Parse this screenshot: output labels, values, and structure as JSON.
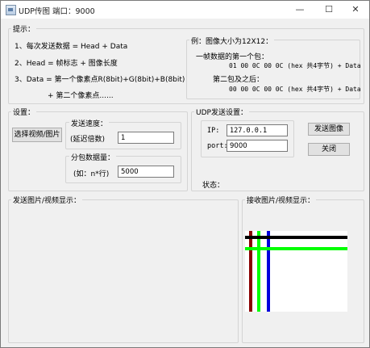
{
  "window": {
    "title": "UDP传图    端口：9000",
    "min_glyph": "—",
    "max_glyph": "☐",
    "close_glyph": "✕"
  },
  "tips": {
    "label": "提示：",
    "line1": "1、每次发送数据 = Head + Data",
    "line2": "2、Head = 帧标志 + 图像长度",
    "line3": "3、Data = 第一个像素点R(8bit)+G(8bit)+B(8bit)",
    "line4": "+ 第二个像素点......",
    "example_label": "例：图像大小为12X12：",
    "first_packet_label": "一帧数据的第一个包：",
    "first_packet_data": "01 00 0C 00 0C  (hex 共4字节) + Data",
    "second_packet_label": "第二包及之后：",
    "second_packet_data": "00 00 0C 00 0C  (hex 共4字节) + Data"
  },
  "settings": {
    "label": "设置：",
    "select_button": "选择视频/图片",
    "speed_label": "发送速度：",
    "delay_label": "(延迟倍数)",
    "delay_value": "1",
    "packet_label": "分包数据量：",
    "packet_unit_label": "(如：n*行)",
    "packet_value": "5000"
  },
  "udp": {
    "label": "UDP发送设置：",
    "ip_label": "IP:",
    "ip_value": "127.0.0.1",
    "port_label": "port:",
    "port_value": "9000",
    "send_button": "发送图像",
    "close_button": "关闭",
    "status_label": "状态："
  },
  "send_display": {
    "label": "发送图片/视频显示："
  },
  "recv_display": {
    "label": "接收图片/视频显示："
  },
  "colors": {
    "black_line": "#000000",
    "green_line": "#00ff00",
    "red_line": "#8b0000",
    "blue_line": "#0000dd"
  }
}
